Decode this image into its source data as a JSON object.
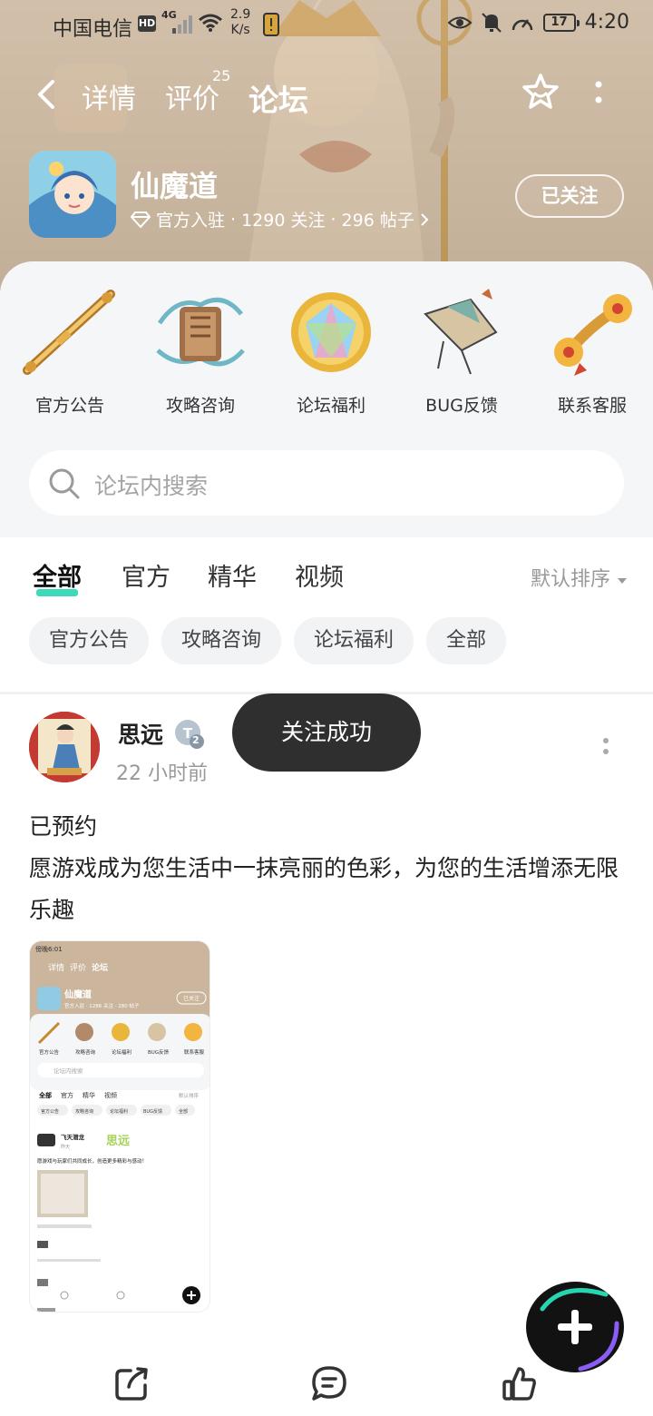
{
  "statusbar": {
    "carrier": "中国电信",
    "hd": "HD",
    "net": "4G",
    "speed_value": "2.9",
    "speed_unit": "K/s",
    "battery": "17",
    "time": "4:20"
  },
  "nav": {
    "tabs": [
      {
        "label": "详情"
      },
      {
        "label": "评价",
        "badge": "25"
      },
      {
        "label": "论坛"
      }
    ]
  },
  "game": {
    "name": "仙魔道",
    "badge": "官方入驻",
    "follows": "1290 关注",
    "posts": "296 帖子",
    "sep": "·",
    "follow_button": "已关注"
  },
  "entries": [
    {
      "label": "官方公告",
      "icon": "staff-icon"
    },
    {
      "label": "攻略咨询",
      "icon": "scroll-icon"
    },
    {
      "label": "论坛福利",
      "icon": "gem-icon"
    },
    {
      "label": "BUG反馈",
      "icon": "kite-icon"
    },
    {
      "label": "联系客服",
      "icon": "ruyi-icon"
    }
  ],
  "search": {
    "placeholder": "论坛内搜索"
  },
  "filter_tabs": [
    "全部",
    "官方",
    "精华",
    "视频"
  ],
  "sort_label": "默认排序",
  "chips": [
    "官方公告",
    "攻略咨询",
    "论坛福利",
    "全部"
  ],
  "post": {
    "user": "思远",
    "level": "2",
    "time": "22 小时前",
    "line1": "已预约",
    "line2": "愿游戏成为您生活中一抹亮丽的色彩，为您的生活增添无限乐趣"
  },
  "toast": "关注成功",
  "thumb": {
    "status": "傍晚6:01",
    "nav": [
      "详情",
      "评价",
      "论坛"
    ],
    "game": "仙魔道",
    "meta": "官方入驻 · 1286 关注 · 280 帖子",
    "follow": "已关注",
    "entries": [
      "官方公告",
      "攻略咨询",
      "论坛福利",
      "BUG反馈",
      "联系客服"
    ],
    "search": "论坛内搜索",
    "tabs": [
      "全部",
      "官方",
      "精华",
      "视频"
    ],
    "sort": "默认排序",
    "chips": [
      "官方公告",
      "攻略咨询",
      "论坛福利",
      "BUG反馈",
      "全部"
    ],
    "user": "飞天潜龙",
    "watermark": "思远",
    "time": "昨天",
    "text": "愿游戏与玩家们共同成长，创造更多精彩与感动！"
  },
  "colors": {
    "accent": "#27d6b0",
    "toast_bg": "#2f2f2f",
    "fab_bg": "#121212"
  }
}
